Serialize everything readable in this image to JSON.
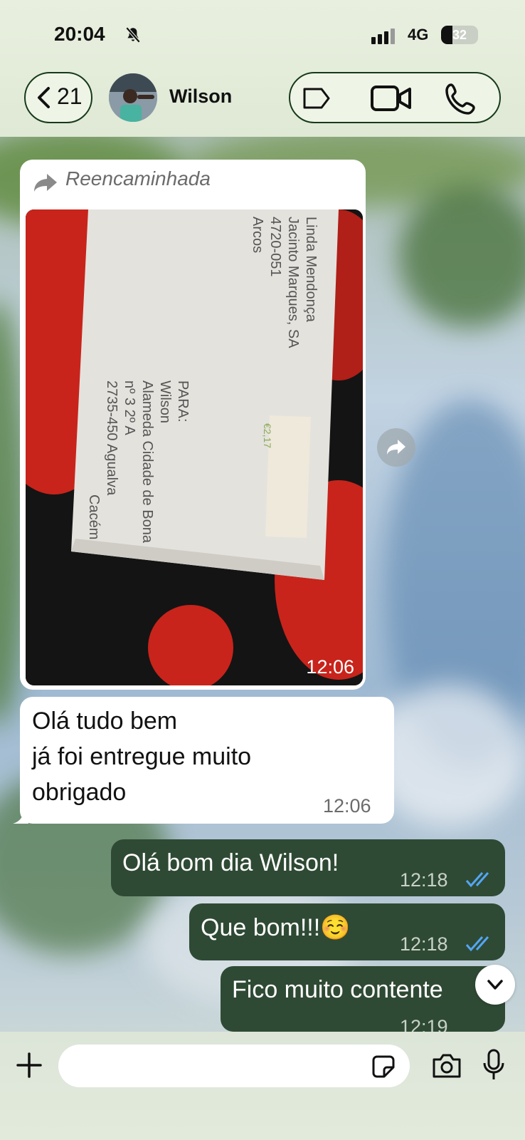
{
  "status_bar": {
    "time": "20:04",
    "network": "4G",
    "battery": "32"
  },
  "header": {
    "back_count": "21",
    "contact_name": "Wilson"
  },
  "messages": {
    "forwarded_label": "Reencaminhada",
    "photo_time": "12:06",
    "incoming_text_1": "Olá tudo bem",
    "incoming_text_2": "já foi entregue muito",
    "incoming_text_3": "obrigado",
    "incoming_time": "12:06",
    "out_1_text": "Olá bom dia Wilson!",
    "out_1_time": "12:18",
    "out_2_text": "Que bom!!!☺️",
    "out_2_time": "12:18",
    "out_3_text": "Fico muito contente",
    "out_3_time": "12:19"
  },
  "photo_content": {
    "envelope_sender_1": "Linda Mendonça",
    "envelope_sender_2": "Jacinto Marques, SA",
    "envelope_sender_3": "4720-051",
    "envelope_sender_4": "Arcos",
    "envelope_to": "PARA:",
    "envelope_name": "Wilson",
    "envelope_addr_1": "Alameda Cidade de Bona",
    "envelope_addr_2": "nº 3 2º A",
    "envelope_addr_3": "2735-450 Agualva",
    "envelope_addr_4": "Cacém",
    "stamp_text": "€2,17"
  },
  "colors": {
    "incoming_bubble": "#ffffff",
    "outgoing_bubble": "#2f4a34",
    "read_ticks": "#53a6f5",
    "header_bg": "#e9efdf"
  },
  "icons": {
    "back": "chevron-left-icon",
    "tag": "label-icon",
    "video": "video-camera-icon",
    "call": "phone-icon",
    "forward": "forward-arrow-icon",
    "add": "plus-icon",
    "sticker": "sticker-icon",
    "camera": "camera-icon",
    "mic": "microphone-icon",
    "scroll": "chevron-down-icon"
  }
}
